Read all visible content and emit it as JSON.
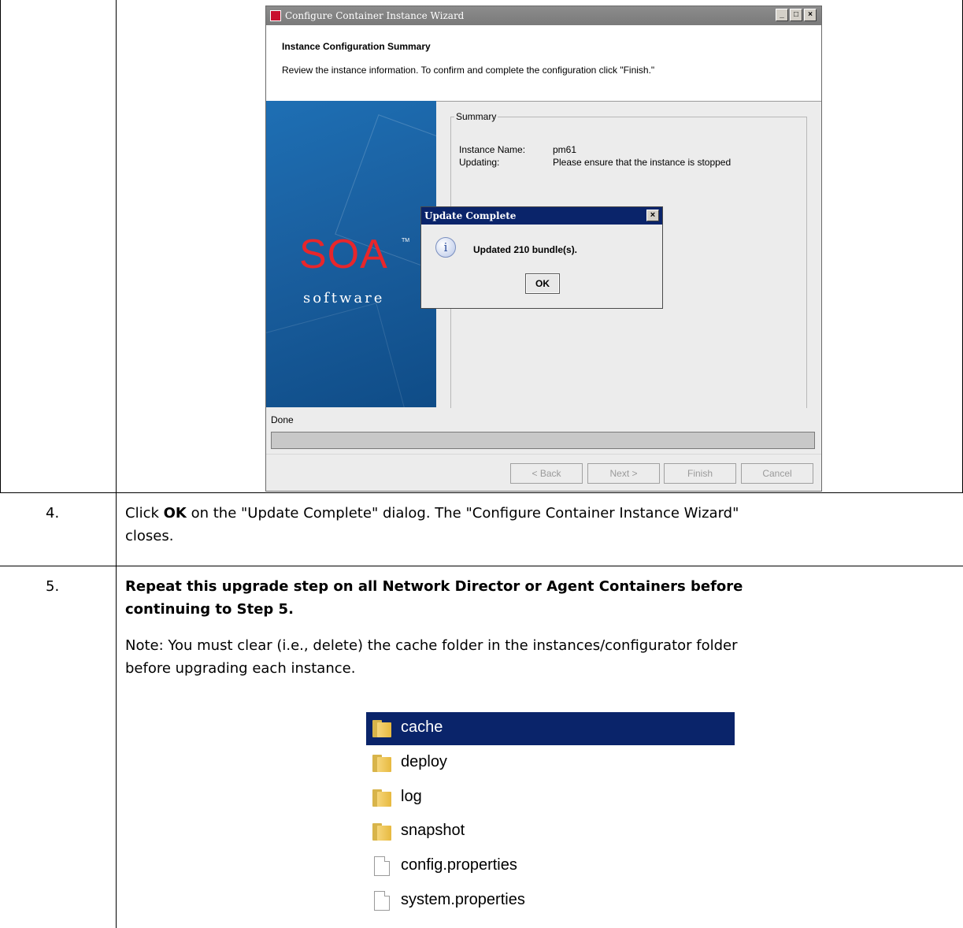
{
  "wizard": {
    "title": "Configure Container Instance Wizard",
    "header_title": "Instance Configuration Summary",
    "header_desc": "Review the instance information. To confirm and complete the configuration click \"Finish.\"",
    "brand_logo": "SOA",
    "brand_tm": "TM",
    "brand_sub": "software",
    "summary_legend": "Summary",
    "instance_name_label": "Instance Name:",
    "instance_name_value": "pm61",
    "updating_label": "Updating:",
    "updating_value": "Please ensure that the instance is stopped",
    "status": "Done",
    "progress": 0,
    "buttons": {
      "back": "< Back",
      "next": "Next >",
      "finish": "Finish",
      "cancel": "Cancel"
    },
    "window_controls": {
      "minimize": "_",
      "maximize": "□",
      "close": "×"
    }
  },
  "dialog": {
    "title": "Update Complete",
    "message": "Updated 210 bundle(s).",
    "ok": "OK",
    "icon_glyph": "i",
    "close_glyph": "×"
  },
  "steps": [
    {
      "number": "4.",
      "line1_prefix": "Click ",
      "line1_bold": "OK",
      "line1_suffix": " on the \"Update Complete\" dialog. The \"Configure Container Instance Wizard\"",
      "line2": "closes."
    },
    {
      "number": "5.",
      "bold_line1": "Repeat this upgrade step on all Network Director or Agent Containers before",
      "bold_line2": "continuing to Step 5.",
      "note_line1": "Note: You must clear (i.e., delete) the cache folder in the instances/configurator folder",
      "note_line2": "before upgrading each instance."
    }
  ],
  "files": [
    {
      "name": "cache",
      "type": "folder",
      "selected": true
    },
    {
      "name": "deploy",
      "type": "folder",
      "selected": false
    },
    {
      "name": "log",
      "type": "folder",
      "selected": false
    },
    {
      "name": "snapshot",
      "type": "folder",
      "selected": false
    },
    {
      "name": "config.properties",
      "type": "file",
      "selected": false
    },
    {
      "name": "system.properties",
      "type": "file",
      "selected": false
    }
  ]
}
